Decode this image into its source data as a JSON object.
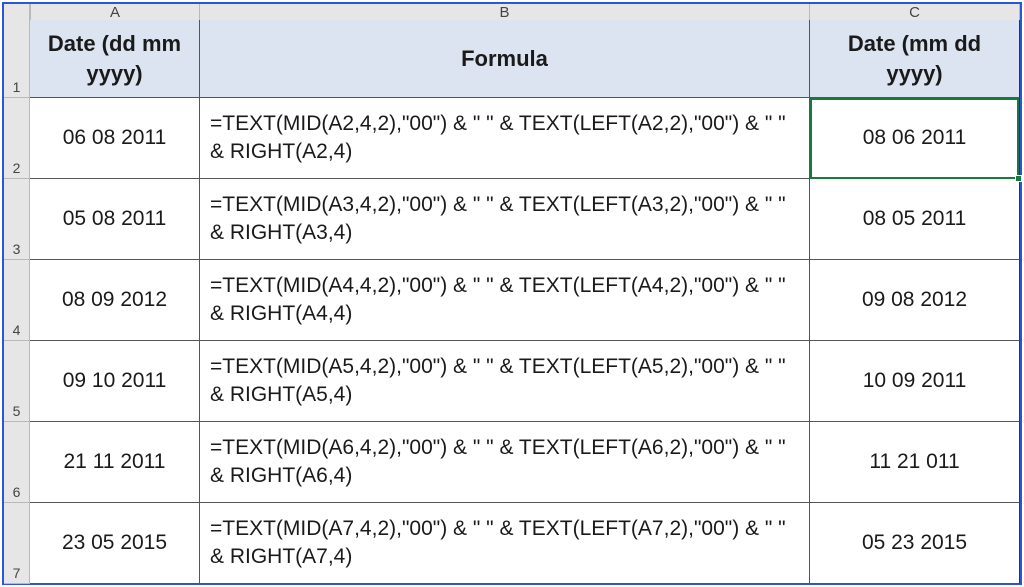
{
  "column_letters": [
    "A",
    "B",
    "C"
  ],
  "row_numbers": [
    "1",
    "2",
    "3",
    "4",
    "5",
    "6",
    "7"
  ],
  "headers": {
    "A": "Date (dd mm yyyy)",
    "B": "Formula",
    "C": "Date (mm dd yyyy)"
  },
  "rows": [
    {
      "A": "06 08 2011",
      "B": "=TEXT(MID(A2,4,2),\"00\") & \" \" & TEXT(LEFT(A2,2),\"00\") & \" \" & RIGHT(A2,4)",
      "C": "08 06 2011"
    },
    {
      "A": "05 08 2011",
      "B": "=TEXT(MID(A3,4,2),\"00\") & \" \" & TEXT(LEFT(A3,2),\"00\") & \" \" & RIGHT(A3,4)",
      "C": "08 05 2011"
    },
    {
      "A": "08 09 2012",
      "B": "=TEXT(MID(A4,4,2),\"00\") & \" \" & TEXT(LEFT(A4,2),\"00\") & \" \" & RIGHT(A4,4)",
      "C": "09 08 2012"
    },
    {
      "A": "09 10 2011",
      "B": "=TEXT(MID(A5,4,2),\"00\") & \" \" & TEXT(LEFT(A5,2),\"00\") & \" \" & RIGHT(A5,4)",
      "C": "10 09 2011"
    },
    {
      "A": "21 11 2011",
      "B": "=TEXT(MID(A6,4,2),\"00\") & \" \" & TEXT(LEFT(A6,2),\"00\") & \" \" & RIGHT(A6,4)",
      "C": "11 21 011"
    },
    {
      "A": "23 05 2015",
      "B": "=TEXT(MID(A7,4,2),\"00\") & \" \" & TEXT(LEFT(A7,2),\"00\") & \" \" & RIGHT(A7,4)",
      "C": "05 23 2015"
    }
  ],
  "selected_cell": "C2"
}
